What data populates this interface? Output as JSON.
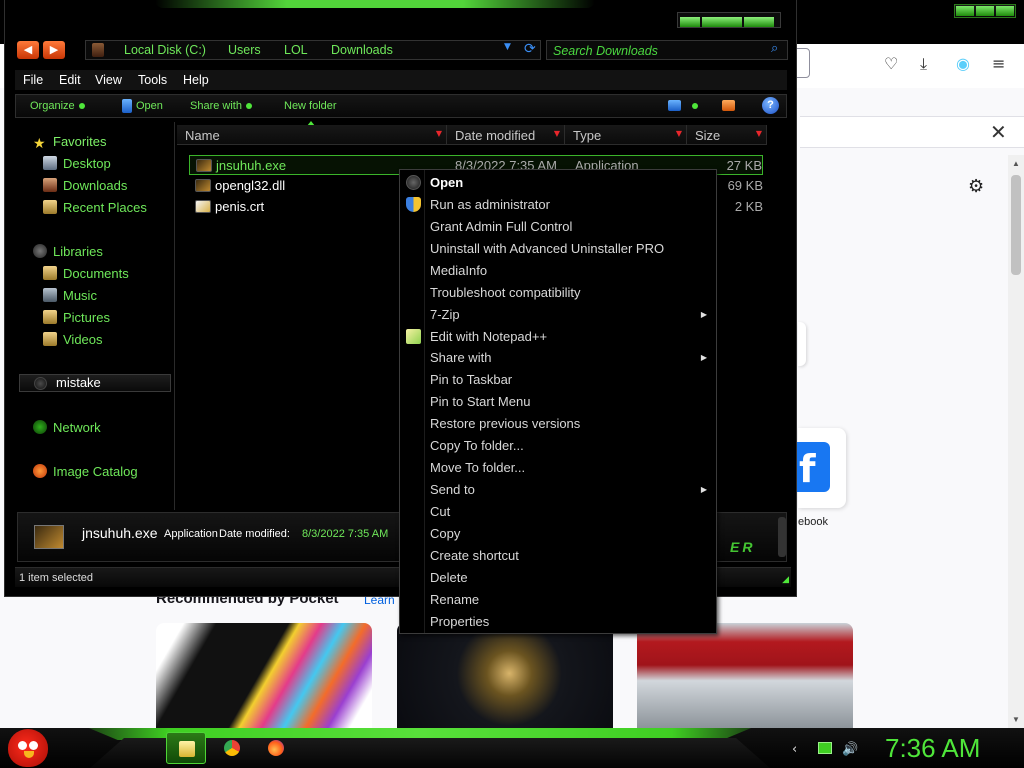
{
  "browser": {
    "facebook_label": "ebook",
    "pocket_title": "Recommended by Pocket",
    "pocket_learn": "Learn",
    "facebook_glyph": "f"
  },
  "explorer": {
    "breadcrumbs": [
      "Local Disk (C:)",
      "Users",
      "LOL",
      "Downloads"
    ],
    "search_placeholder": "Search Downloads",
    "menu": [
      "File",
      "Edit",
      "View",
      "Tools",
      "Help"
    ],
    "commands": {
      "organize": "Organize",
      "open": "Open",
      "share": "Share with",
      "new_folder": "New folder"
    },
    "nav": {
      "favorites": "Favorites",
      "desktop": "Desktop",
      "downloads": "Downloads",
      "recent": "Recent Places",
      "libraries": "Libraries",
      "documents": "Documents",
      "music": "Music",
      "pictures": "Pictures",
      "videos": "Videos",
      "mistake": "mistake",
      "network": "Network",
      "image_catalog": "Image Catalog"
    },
    "columns": {
      "name": "Name",
      "date": "Date modified",
      "type": "Type",
      "size": "Size"
    },
    "files": [
      {
        "name": "jnsuhuh.exe",
        "date": "8/3/2022 7:35 AM",
        "type": "Application",
        "size": "27 KB"
      },
      {
        "name": "opengl32.dll",
        "date": "",
        "type": "",
        "size": "69 KB"
      },
      {
        "name": "penis.crt",
        "date": "",
        "type": "",
        "size": "2 KB"
      }
    ],
    "details": {
      "name": "jnsuhuh.exe",
      "type": "Application",
      "date_label": "Date modified:",
      "date": "8/3/2022 7:35 AM",
      "logo": "ER"
    },
    "status": "1 item selected"
  },
  "context_menu": [
    {
      "label": "Open",
      "default": true,
      "icon": "open-icon"
    },
    {
      "label": "Run as administrator",
      "icon": "uac-shield-icon"
    },
    {
      "label": "Grant Admin Full Control"
    },
    {
      "label": "Uninstall with Advanced Uninstaller PRO"
    },
    {
      "label": "MediaInfo"
    },
    {
      "label": "Troubleshoot compatibility"
    },
    {
      "label": "7-Zip",
      "submenu": true
    },
    {
      "label": "Edit with Notepad++",
      "icon": "notepadpp-icon"
    },
    {
      "label": "Share with",
      "submenu": true
    },
    {
      "label": "Pin to Taskbar"
    },
    {
      "label": "Pin to Start Menu"
    },
    {
      "label": "Restore previous versions"
    },
    {
      "label": "Copy To folder..."
    },
    {
      "label": "Move To folder..."
    },
    {
      "label": "Send to",
      "submenu": true
    },
    {
      "label": "Cut"
    },
    {
      "label": "Copy"
    },
    {
      "label": "Create shortcut"
    },
    {
      "label": "Delete"
    },
    {
      "label": "Rename"
    },
    {
      "label": "Properties"
    }
  ],
  "taskbar": {
    "clock": "7:36 AM"
  },
  "colors": {
    "accent_green": "#4fe63a",
    "text_green": "#6fe85a",
    "sort_arrow_red": "#e8262b",
    "background_black": "#000000"
  }
}
